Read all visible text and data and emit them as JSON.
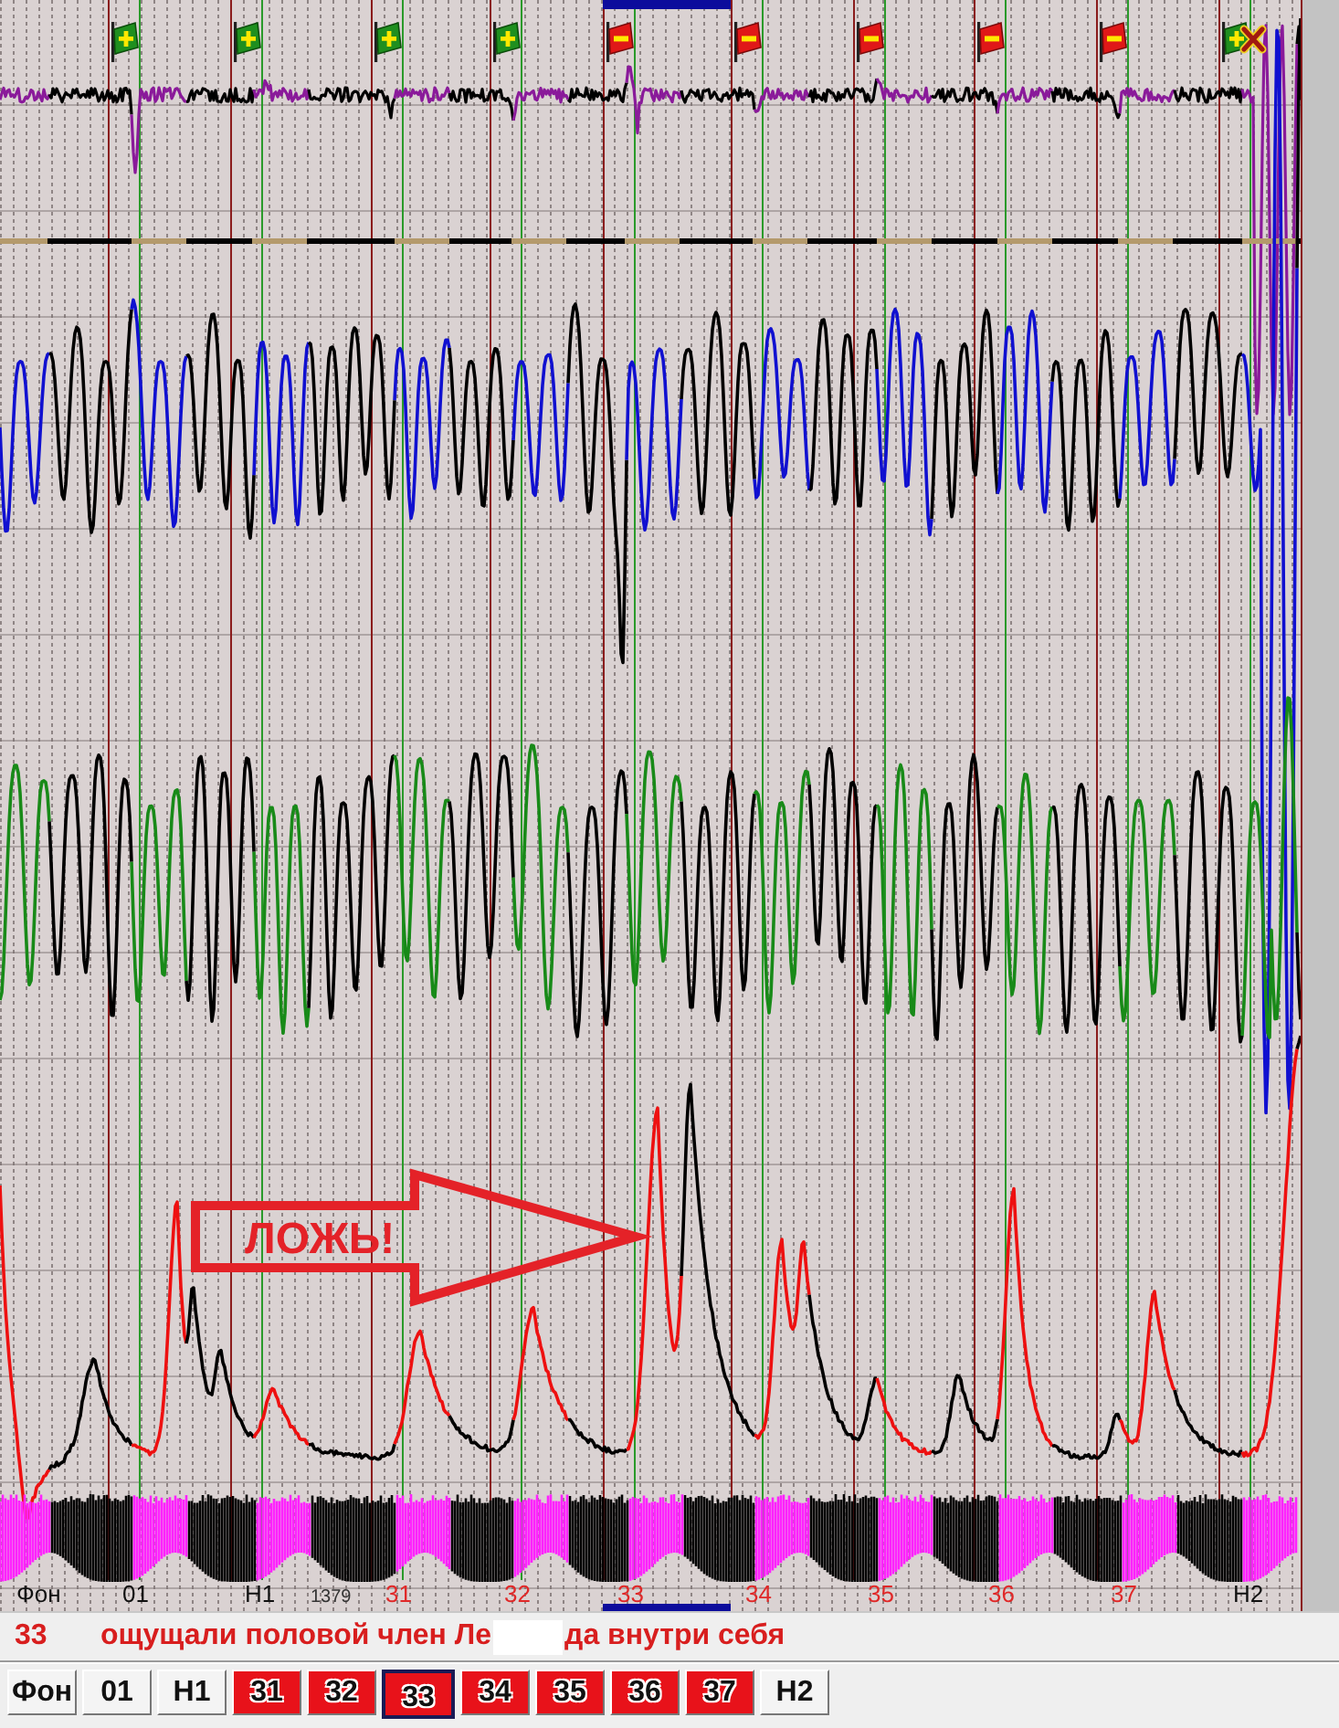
{
  "chart": {
    "timeline": [
      {
        "label": "Фон",
        "kind": "neutral",
        "selected": false
      },
      {
        "label": "01",
        "kind": "neutral",
        "flag": {
          "kind": "plus",
          "rejected": false
        },
        "selected": false
      },
      {
        "label": "Н1",
        "kind": "neutral",
        "flag": {
          "kind": "plus",
          "rejected": false
        },
        "selected": false
      },
      {
        "label": "31",
        "kind": "relevant",
        "flag": {
          "kind": "plus",
          "rejected": false
        },
        "selected": false
      },
      {
        "label": "32",
        "kind": "relevant",
        "flag": {
          "kind": "plus",
          "rejected": false
        },
        "selected": false
      },
      {
        "label": "33",
        "kind": "relevant",
        "flag": {
          "kind": "minus",
          "rejected": false
        },
        "selected": true
      },
      {
        "label": "34",
        "kind": "relevant",
        "flag": {
          "kind": "minus",
          "rejected": false
        },
        "selected": false
      },
      {
        "label": "35",
        "kind": "relevant",
        "flag": {
          "kind": "minus",
          "rejected": false
        },
        "selected": false
      },
      {
        "label": "36",
        "kind": "relevant",
        "flag": {
          "kind": "minus",
          "rejected": false
        },
        "selected": false
      },
      {
        "label": "37",
        "kind": "relevant",
        "flag": {
          "kind": "minus",
          "rejected": false
        },
        "selected": false
      },
      {
        "label": "Н2",
        "kind": "neutral",
        "flag": {
          "kind": "plus",
          "rejected": true
        },
        "selected": false
      }
    ],
    "time_label": "1379",
    "annotation": {
      "text": "ЛОЖЬ!"
    }
  },
  "question": {
    "number": "33",
    "text_before": "ощущали половой член Ле",
    "text_after": "да внутри себя"
  },
  "tabs": [
    {
      "label": "Фон",
      "kind": "neutral",
      "selected": false
    },
    {
      "label": "01",
      "kind": "neutral",
      "selected": false
    },
    {
      "label": "Н1",
      "kind": "neutral",
      "selected": false
    },
    {
      "label": "31",
      "kind": "relevant",
      "selected": false
    },
    {
      "label": "32",
      "kind": "relevant",
      "selected": false
    },
    {
      "label": "33",
      "kind": "relevant",
      "selected": true
    },
    {
      "label": "34",
      "kind": "relevant",
      "selected": false
    },
    {
      "label": "35",
      "kind": "relevant",
      "selected": false
    },
    {
      "label": "36",
      "kind": "relevant",
      "selected": false
    },
    {
      "label": "37",
      "kind": "relevant",
      "selected": false
    },
    {
      "label": "Н2",
      "kind": "neutral",
      "selected": false
    }
  ]
}
